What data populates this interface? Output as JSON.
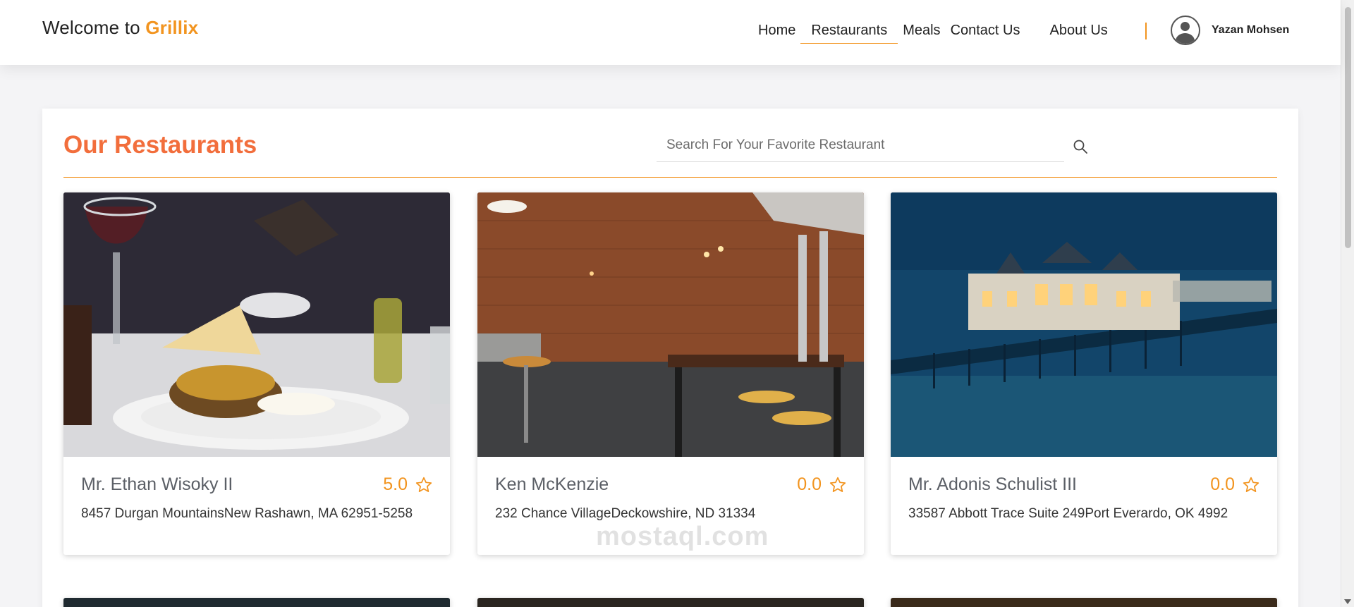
{
  "header": {
    "brand_prefix": "Welcome to ",
    "brand_name": "Grillix",
    "nav": [
      {
        "label": "Home"
      },
      {
        "label": "Restaurants"
      },
      {
        "label": "Meals"
      },
      {
        "label": "Contact Us"
      },
      {
        "label": "About Us"
      }
    ],
    "active_nav": "Restaurants",
    "user_name": "Yazan Mohsen"
  },
  "main": {
    "title": "Our Restaurants",
    "search_placeholder": "Search For Your Favorite Restaurant"
  },
  "restaurants": [
    {
      "name": "Mr. Ethan Wisoky II",
      "rating": "5.0",
      "address": "8457 Durgan MountainsNew Rashawn, MA 62951-5258"
    },
    {
      "name": "Ken McKenzie",
      "rating": "0.0",
      "address": "232 Chance VillageDeckowshire, ND 31334"
    },
    {
      "name": "Mr. Adonis Schulist III",
      "rating": "0.0",
      "address": "33587 Abbott Trace Suite 249Port Everardo, OK 4992"
    }
  ],
  "watermark": "mostaql.com",
  "colors": {
    "accent": "#f2941f",
    "title": "#f26e3c"
  },
  "icons": [
    "user-avatar-icon",
    "search-icon",
    "star-outline-icon"
  ]
}
